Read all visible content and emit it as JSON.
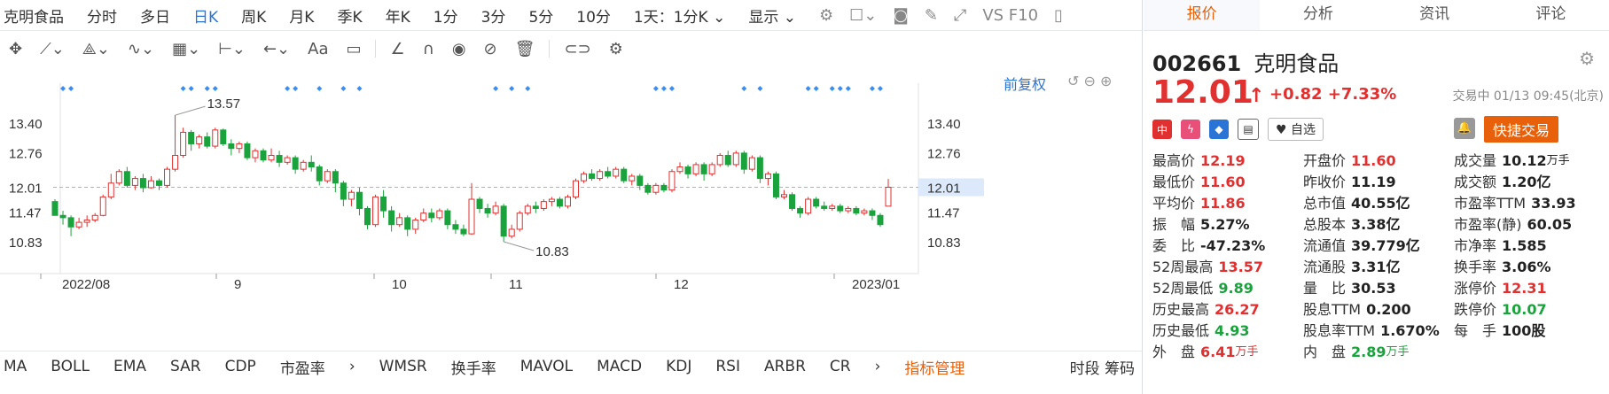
{
  "topbar": {
    "stock": "克明食品",
    "tabs": [
      "分时",
      "多日",
      "日K",
      "周K",
      "月K",
      "季K",
      "年K",
      "1分",
      "3分",
      "5分",
      "10分"
    ],
    "active_tab": "日K",
    "period_select": "1天：1分K",
    "display": "显示",
    "vs_label": "VS F10"
  },
  "chart": {
    "fq_label": "前复权",
    "high_label": "13.57",
    "low_label": "10.83",
    "current_label": "12.01",
    "y_ticks": [
      "13.40",
      "12.76",
      "12.01",
      "11.47",
      "10.83"
    ],
    "x_ticks": [
      "2022/08",
      "9",
      "10",
      "11",
      "12",
      "2023/01"
    ]
  },
  "chart_data": {
    "type": "candlestick",
    "y_ticks": [
      13.4,
      12.76,
      12.01,
      11.47,
      10.83
    ],
    "ylim": [
      10.6,
      13.8
    ],
    "reference_price": 12.01,
    "period_high": 13.57,
    "period_low": 10.83,
    "x_labels": [
      "2022/08",
      "9",
      "10",
      "11",
      "12",
      "2023/01"
    ],
    "candles": [
      {
        "o": 11.7,
        "c": 11.4,
        "h": 11.75,
        "l": 11.4
      },
      {
        "o": 11.4,
        "c": 11.35,
        "h": 11.5,
        "l": 11.2
      },
      {
        "o": 11.35,
        "c": 11.15,
        "h": 11.4,
        "l": 10.95
      },
      {
        "o": 11.15,
        "c": 11.25,
        "h": 11.35,
        "l": 11.1
      },
      {
        "o": 11.25,
        "c": 11.3,
        "h": 11.4,
        "l": 11.15
      },
      {
        "o": 11.3,
        "c": 11.4,
        "h": 11.45,
        "l": 11.25
      },
      {
        "o": 11.4,
        "c": 11.8,
        "h": 11.85,
        "l": 11.38
      },
      {
        "o": 11.8,
        "c": 12.1,
        "h": 12.3,
        "l": 11.75
      },
      {
        "o": 12.1,
        "c": 12.35,
        "h": 12.4,
        "l": 12.05
      },
      {
        "o": 12.35,
        "c": 12.05,
        "h": 12.45,
        "l": 12.0
      },
      {
        "o": 12.05,
        "c": 12.2,
        "h": 12.25,
        "l": 11.95
      },
      {
        "o": 12.2,
        "c": 12.0,
        "h": 12.3,
        "l": 11.9
      },
      {
        "o": 12.0,
        "c": 12.15,
        "h": 12.25,
        "l": 11.98
      },
      {
        "o": 12.15,
        "c": 12.05,
        "h": 12.2,
        "l": 11.95
      },
      {
        "o": 12.05,
        "c": 12.4,
        "h": 12.45,
        "l": 12.0
      },
      {
        "o": 12.4,
        "c": 12.7,
        "h": 13.57,
        "l": 12.35
      },
      {
        "o": 12.7,
        "c": 13.2,
        "h": 13.3,
        "l": 12.65
      },
      {
        "o": 13.2,
        "c": 12.95,
        "h": 13.25,
        "l": 12.8
      },
      {
        "o": 12.95,
        "c": 13.1,
        "h": 13.15,
        "l": 12.85
      },
      {
        "o": 13.1,
        "c": 12.9,
        "h": 13.2,
        "l": 12.85
      },
      {
        "o": 12.9,
        "c": 13.25,
        "h": 13.3,
        "l": 12.85
      },
      {
        "o": 13.25,
        "c": 12.95,
        "h": 13.28,
        "l": 12.9
      },
      {
        "o": 12.95,
        "c": 12.85,
        "h": 13.05,
        "l": 12.7
      },
      {
        "o": 12.85,
        "c": 12.95,
        "h": 13.0,
        "l": 12.75
      },
      {
        "o": 12.95,
        "c": 12.65,
        "h": 13.0,
        "l": 12.6
      },
      {
        "o": 12.65,
        "c": 12.8,
        "h": 12.85,
        "l": 12.55
      },
      {
        "o": 12.8,
        "c": 12.6,
        "h": 12.85,
        "l": 12.55
      },
      {
        "o": 12.6,
        "c": 12.7,
        "h": 12.85,
        "l": 12.55
      },
      {
        "o": 12.7,
        "c": 12.55,
        "h": 12.8,
        "l": 12.45
      },
      {
        "o": 12.55,
        "c": 12.65,
        "h": 12.7,
        "l": 12.5
      },
      {
        "o": 12.65,
        "c": 12.4,
        "h": 12.7,
        "l": 12.3
      },
      {
        "o": 12.4,
        "c": 12.55,
        "h": 12.6,
        "l": 12.35
      },
      {
        "o": 12.55,
        "c": 12.45,
        "h": 12.7,
        "l": 12.35
      },
      {
        "o": 12.45,
        "c": 12.15,
        "h": 12.5,
        "l": 12.05
      },
      {
        "o": 12.15,
        "c": 12.35,
        "h": 12.4,
        "l": 12.1
      },
      {
        "o": 12.35,
        "c": 12.1,
        "h": 12.4,
        "l": 11.9
      },
      {
        "o": 12.1,
        "c": 11.75,
        "h": 12.15,
        "l": 11.6
      },
      {
        "o": 11.75,
        "c": 11.9,
        "h": 11.95,
        "l": 11.6
      },
      {
        "o": 11.9,
        "c": 11.55,
        "h": 12.0,
        "l": 11.4
      },
      {
        "o": 11.55,
        "c": 11.2,
        "h": 11.6,
        "l": 11.1
      },
      {
        "o": 11.2,
        "c": 11.8,
        "h": 11.85,
        "l": 11.15
      },
      {
        "o": 11.8,
        "c": 11.5,
        "h": 11.95,
        "l": 11.35
      },
      {
        "o": 11.5,
        "c": 11.2,
        "h": 11.6,
        "l": 11.05
      },
      {
        "o": 11.2,
        "c": 11.35,
        "h": 11.45,
        "l": 11.15
      },
      {
        "o": 11.35,
        "c": 11.1,
        "h": 11.4,
        "l": 10.95
      },
      {
        "o": 11.1,
        "c": 11.3,
        "h": 11.35,
        "l": 11.0
      },
      {
        "o": 11.3,
        "c": 11.45,
        "h": 11.55,
        "l": 11.25
      },
      {
        "o": 11.45,
        "c": 11.35,
        "h": 11.55,
        "l": 11.25
      },
      {
        "o": 11.35,
        "c": 11.5,
        "h": 11.55,
        "l": 11.3
      },
      {
        "o": 11.5,
        "c": 11.2,
        "h": 11.55,
        "l": 11.1
      },
      {
        "o": 11.2,
        "c": 11.1,
        "h": 11.3,
        "l": 11.0
      },
      {
        "o": 11.1,
        "c": 11.0,
        "h": 11.2,
        "l": 10.95
      },
      {
        "o": 11.0,
        "c": 11.75,
        "h": 12.1,
        "l": 10.98
      },
      {
        "o": 11.75,
        "c": 11.55,
        "h": 11.8,
        "l": 11.45
      },
      {
        "o": 11.55,
        "c": 11.45,
        "h": 11.65,
        "l": 11.35
      },
      {
        "o": 11.45,
        "c": 11.6,
        "h": 11.7,
        "l": 11.4
      },
      {
        "o": 11.6,
        "c": 10.95,
        "h": 11.65,
        "l": 10.83
      },
      {
        "o": 10.95,
        "c": 11.1,
        "h": 11.2,
        "l": 10.9
      },
      {
        "o": 11.1,
        "c": 11.45,
        "h": 11.5,
        "l": 11.05
      },
      {
        "o": 11.45,
        "c": 11.6,
        "h": 11.65,
        "l": 11.4
      },
      {
        "o": 11.6,
        "c": 11.55,
        "h": 11.7,
        "l": 11.45
      },
      {
        "o": 11.55,
        "c": 11.7,
        "h": 11.75,
        "l": 11.5
      },
      {
        "o": 11.7,
        "c": 11.75,
        "h": 11.8,
        "l": 11.6
      },
      {
        "o": 11.75,
        "c": 11.6,
        "h": 11.8,
        "l": 11.55
      },
      {
        "o": 11.6,
        "c": 11.8,
        "h": 11.85,
        "l": 11.55
      },
      {
        "o": 11.8,
        "c": 12.15,
        "h": 12.2,
        "l": 11.75
      },
      {
        "o": 12.15,
        "c": 12.3,
        "h": 12.35,
        "l": 12.1
      },
      {
        "o": 12.3,
        "c": 12.2,
        "h": 12.4,
        "l": 12.15
      },
      {
        "o": 12.2,
        "c": 12.35,
        "h": 12.4,
        "l": 12.15
      },
      {
        "o": 12.35,
        "c": 12.25,
        "h": 12.45,
        "l": 12.2
      },
      {
        "o": 12.25,
        "c": 12.4,
        "h": 12.45,
        "l": 12.2
      },
      {
        "o": 12.4,
        "c": 12.15,
        "h": 12.45,
        "l": 12.1
      },
      {
        "o": 12.15,
        "c": 12.25,
        "h": 12.3,
        "l": 12.05
      },
      {
        "o": 12.25,
        "c": 12.05,
        "h": 12.3,
        "l": 11.95
      },
      {
        "o": 12.05,
        "c": 11.9,
        "h": 12.1,
        "l": 11.85
      },
      {
        "o": 11.9,
        "c": 12.05,
        "h": 12.1,
        "l": 11.85
      },
      {
        "o": 12.05,
        "c": 11.95,
        "h": 12.1,
        "l": 11.9
      },
      {
        "o": 11.95,
        "c": 12.35,
        "h": 12.4,
        "l": 11.9
      },
      {
        "o": 12.35,
        "c": 12.45,
        "h": 12.55,
        "l": 12.3
      },
      {
        "o": 12.45,
        "c": 12.3,
        "h": 12.5,
        "l": 12.2
      },
      {
        "o": 12.3,
        "c": 12.5,
        "h": 12.55,
        "l": 12.25
      },
      {
        "o": 12.5,
        "c": 12.3,
        "h": 12.55,
        "l": 12.15
      },
      {
        "o": 12.3,
        "c": 12.5,
        "h": 12.55,
        "l": 12.25
      },
      {
        "o": 12.5,
        "c": 12.7,
        "h": 12.75,
        "l": 12.45
      },
      {
        "o": 12.7,
        "c": 12.5,
        "h": 12.8,
        "l": 12.45
      },
      {
        "o": 12.5,
        "c": 12.75,
        "h": 12.8,
        "l": 12.45
      },
      {
        "o": 12.75,
        "c": 12.4,
        "h": 12.8,
        "l": 12.3
      },
      {
        "o": 12.4,
        "c": 12.65,
        "h": 12.7,
        "l": 12.35
      },
      {
        "o": 12.65,
        "c": 12.2,
        "h": 12.7,
        "l": 12.1
      },
      {
        "o": 12.2,
        "c": 12.3,
        "h": 12.35,
        "l": 12.05
      },
      {
        "o": 12.3,
        "c": 11.8,
        "h": 12.35,
        "l": 11.75
      },
      {
        "o": 11.8,
        "c": 11.85,
        "h": 11.95,
        "l": 11.75
      },
      {
        "o": 11.85,
        "c": 11.55,
        "h": 11.9,
        "l": 11.5
      },
      {
        "o": 11.55,
        "c": 11.45,
        "h": 11.6,
        "l": 11.35
      },
      {
        "o": 11.45,
        "c": 11.75,
        "h": 11.8,
        "l": 11.4
      },
      {
        "o": 11.75,
        "c": 11.6,
        "h": 11.8,
        "l": 11.55
      },
      {
        "o": 11.6,
        "c": 11.55,
        "h": 11.7,
        "l": 11.5
      },
      {
        "o": 11.55,
        "c": 11.6,
        "h": 11.65,
        "l": 11.5
      },
      {
        "o": 11.6,
        "c": 11.5,
        "h": 11.65,
        "l": 11.45
      },
      {
        "o": 11.5,
        "c": 11.55,
        "h": 11.6,
        "l": 11.45
      },
      {
        "o": 11.55,
        "c": 11.45,
        "h": 11.6,
        "l": 11.4
      },
      {
        "o": 11.45,
        "c": 11.5,
        "h": 11.55,
        "l": 11.4
      },
      {
        "o": 11.5,
        "c": 11.4,
        "h": 11.55,
        "l": 11.3
      },
      {
        "o": 11.4,
        "c": 11.2,
        "h": 11.45,
        "l": 11.15
      },
      {
        "o": 11.6,
        "c": 12.01,
        "h": 12.19,
        "l": 11.6
      }
    ]
  },
  "indicators": {
    "items": [
      "MA",
      "BOLL",
      "EMA",
      "SAR",
      "CDP",
      "市盈率"
    ],
    "items2": [
      "WMSR",
      "换手率",
      "MAVOL",
      "MACD",
      "KDJ",
      "RSI",
      "ARBR",
      "CR"
    ],
    "manage": "指标管理",
    "right": "时段 筹码"
  },
  "quote": {
    "tabs": [
      "报价",
      "分析",
      "资讯",
      "评论"
    ],
    "active_tab": "报价",
    "code": "002661",
    "name": "克明食品",
    "price": "12.01",
    "change": "+0.82",
    "change_pct": "+7.33%",
    "status": "交易中 01/13 09:45(北京)",
    "badge_cn": "中",
    "badge_hot": "ϟ",
    "badge_tag": "◆",
    "badge_doc": "▤",
    "watch": "自选",
    "quick_trade": "快捷交易",
    "rows": [
      [
        {
          "l": "最高价",
          "v": "12.19",
          "c": "red"
        },
        {
          "l": "开盘价",
          "v": "11.60",
          "c": "red"
        },
        {
          "l": "成交量",
          "v": "10.12",
          "u": "万手",
          "c": "dark"
        }
      ],
      [
        {
          "l": "最低价",
          "v": "11.60",
          "c": "red"
        },
        {
          "l": "昨收价",
          "v": "11.19",
          "c": "dark"
        },
        {
          "l": "成交额",
          "v": "1.20亿",
          "c": "dark"
        }
      ],
      [
        {
          "l": "平均价",
          "v": "11.86",
          "c": "red"
        },
        {
          "l": "总市值",
          "v": "40.55亿",
          "c": "dark"
        },
        {
          "l": "市盈率TTM",
          "v": "33.93",
          "c": "dark"
        }
      ],
      [
        {
          "l": "振　幅",
          "v": "5.27%",
          "c": "dark"
        },
        {
          "l": "总股本",
          "v": "3.38亿",
          "c": "dark"
        },
        {
          "l": "市盈率(静)",
          "v": "60.05",
          "c": "dark"
        }
      ],
      [
        {
          "l": "委　比",
          "v": "-47.23%",
          "c": "dark"
        },
        {
          "l": "流通值",
          "v": "39.779亿",
          "c": "dark"
        },
        {
          "l": "市净率",
          "v": "1.585",
          "c": "dark"
        }
      ],
      [
        {
          "l": "52周最高",
          "v": "13.57",
          "c": "red"
        },
        {
          "l": "流通股",
          "v": "3.31亿",
          "c": "dark"
        },
        {
          "l": "换手率",
          "v": "3.06%",
          "c": "dark"
        }
      ],
      [
        {
          "l": "52周最低",
          "v": "9.89",
          "c": "green"
        },
        {
          "l": "量　比",
          "v": "30.53",
          "c": "dark"
        },
        {
          "l": "涨停价",
          "v": "12.31",
          "c": "red"
        }
      ],
      [
        {
          "l": "历史最高",
          "v": "26.27",
          "c": "red"
        },
        {
          "l": "股息TTM",
          "v": "0.200",
          "c": "dark"
        },
        {
          "l": "跌停价",
          "v": "10.07",
          "c": "green"
        }
      ],
      [
        {
          "l": "历史最低",
          "v": "4.93",
          "c": "green"
        },
        {
          "l": "股息率TTM",
          "v": "1.670%",
          "c": "dark"
        },
        {
          "l": "每　手",
          "v": "100股",
          "c": "dark"
        }
      ],
      [
        {
          "l": "外　盘",
          "v": "6.41",
          "u": "万手",
          "c": "red"
        },
        {
          "l": "内　盘",
          "v": "2.89",
          "u": "万手",
          "c": "green"
        },
        {
          "l": "",
          "v": "",
          "c": "dark"
        }
      ]
    ]
  },
  "colors": {
    "up": "#e03030",
    "down": "#1aa33c",
    "accent": "#2a74d6",
    "orange": "#e8600a"
  }
}
